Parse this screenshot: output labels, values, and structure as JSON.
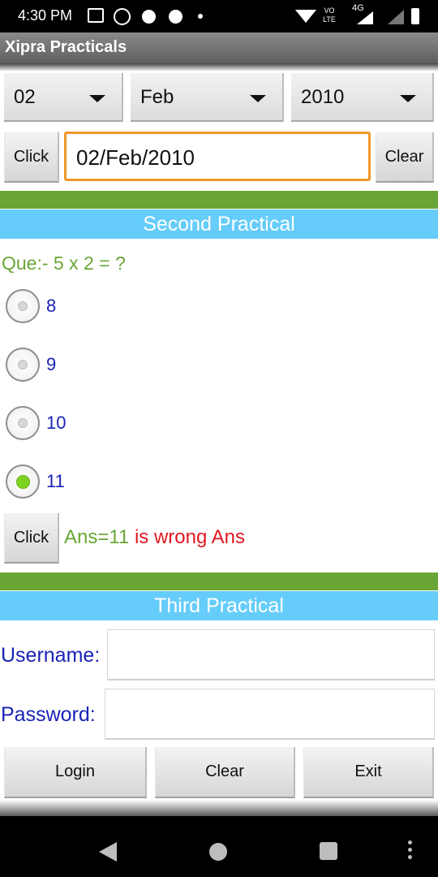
{
  "status_bar": {
    "time": "4:30 PM",
    "left_icons": [
      "news-icon",
      "whatsapp-icon",
      "jio-icon",
      "jio-icon",
      "dot-icon"
    ],
    "right_icons": [
      "wifi-icon",
      "volte-icon",
      "signal-4g-icon",
      "signal-empty-icon",
      "battery-icon"
    ],
    "volte_text": "VO LTE",
    "network_text": "4G"
  },
  "app": {
    "title": "Xipra Practicals"
  },
  "date_section": {
    "day": "02",
    "month": "Feb",
    "year": "2010",
    "click_label": "Click",
    "date_value": "02/Feb/2010",
    "clear_label": "Clear"
  },
  "second_practical": {
    "heading": "Second Practical",
    "question": "Que:- 5 x 2 = ?",
    "options": [
      {
        "label": "8",
        "checked": false
      },
      {
        "label": "9",
        "checked": false
      },
      {
        "label": "10",
        "checked": false
      },
      {
        "label": "11",
        "checked": true
      }
    ],
    "click_label": "Click",
    "answer_prefix": "Ans=11",
    "answer_verdict": " is wrong Ans"
  },
  "third_practical": {
    "heading": "Third Practical",
    "username_label": "Username:",
    "username_value": "",
    "password_label": "Password:",
    "password_value": "",
    "login_label": "Login",
    "clear_label": "Clear",
    "exit_label": "Exit"
  },
  "colors": {
    "accent_green": "#6aa636",
    "heading_blue": "#66ccfa",
    "label_blue": "#1a23b5",
    "wrong_red": "#e0181f",
    "focus_orange": "#f0962a"
  }
}
